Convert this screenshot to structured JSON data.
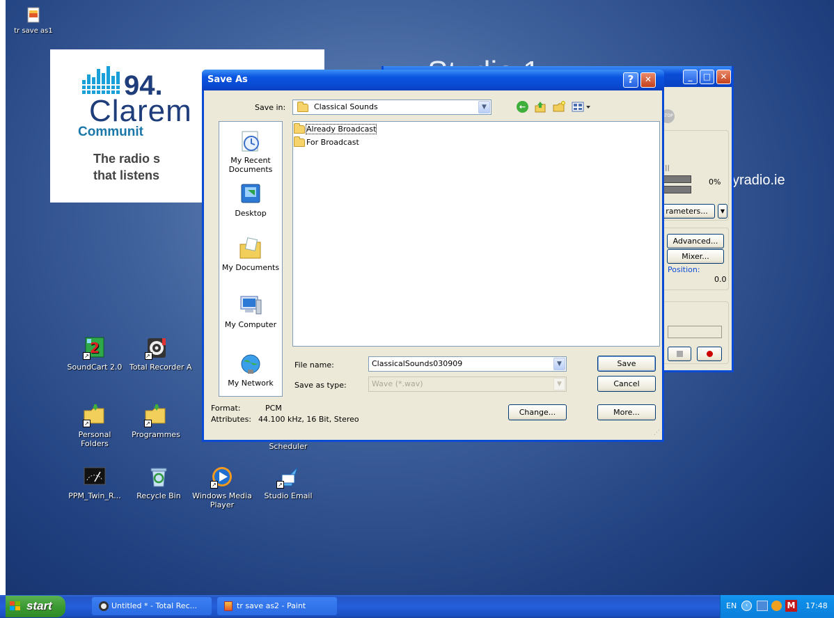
{
  "desktop": {
    "top_icon": {
      "label": "tr save as1"
    },
    "logo": {
      "number": "94.",
      "name": "Clarem",
      "community": "Communit",
      "tagline_1": "The radio s",
      "tagline_2": "that listens"
    },
    "studio_title": "Studio 1",
    "web_text": "yradio.ie",
    "icons": [
      {
        "label": "SoundCart 2.0",
        "icon": "soundcart-icon"
      },
      {
        "label": "Total Recorder A",
        "icon": "total-recorder-icon"
      },
      {
        "label": "Personal Folders",
        "icon": "folder-shortcut-icon"
      },
      {
        "label": "Programmes",
        "icon": "folder-shortcut-icon"
      },
      {
        "label": "Scheduler",
        "icon": "scheduler-icon"
      },
      {
        "label": "PPM_Twin_R...",
        "icon": "meter-icon"
      },
      {
        "label": "Recycle Bin",
        "icon": "recycle-bin-icon"
      },
      {
        "label": "Windows Media Player",
        "icon": "media-player-icon"
      },
      {
        "label": "Studio Email",
        "icon": "email-icon"
      }
    ]
  },
  "back_window": {
    "percent": "0%",
    "parameters_label": "rameters...",
    "advanced_label": "Advanced...",
    "mixer_label": "Mixer...",
    "position_label": "Position:",
    "position_value": "0.0",
    "stop_label": "STOP"
  },
  "dialog": {
    "title": "Save As",
    "save_in_label": "Save in:",
    "save_in_value": "Classical Sounds",
    "places": [
      {
        "label": "My Recent Documents",
        "icon": "recent-documents-icon"
      },
      {
        "label": "Desktop",
        "icon": "desktop-icon"
      },
      {
        "label": "My Documents",
        "icon": "my-documents-icon"
      },
      {
        "label": "My Computer",
        "icon": "my-computer-icon"
      },
      {
        "label": "My Network",
        "icon": "my-network-icon"
      }
    ],
    "files": [
      {
        "name": "Already Broadcast",
        "selected": true
      },
      {
        "name": "For Broadcast",
        "selected": false
      }
    ],
    "file_name_label": "File name:",
    "file_name_value": "ClassicalSounds030909",
    "save_as_type_label": "Save as type:",
    "save_as_type_value": "Wave (*.wav)",
    "save_button": "Save",
    "cancel_button": "Cancel",
    "change_button": "Change...",
    "more_button": "More...",
    "format_label": "Format:",
    "format_value": "PCM",
    "attributes_label": "Attributes:",
    "attributes_value": "44.100 kHz, 16 Bit, Stereo",
    "help_button": "?"
  },
  "taskbar": {
    "start_label": "start",
    "tasks": [
      {
        "label": "Untitled * - Total Rec...",
        "icon": "total-recorder-icon"
      },
      {
        "label": "tr save as2 - Paint",
        "icon": "paint-icon"
      }
    ],
    "language": "EN",
    "clock": "17:48"
  },
  "colors": {
    "titlebar_blue": "#0a4bd6",
    "dialog_face": "#ece9d8",
    "start_green": "#3c9a33",
    "taskbar_blue": "#245edb"
  }
}
